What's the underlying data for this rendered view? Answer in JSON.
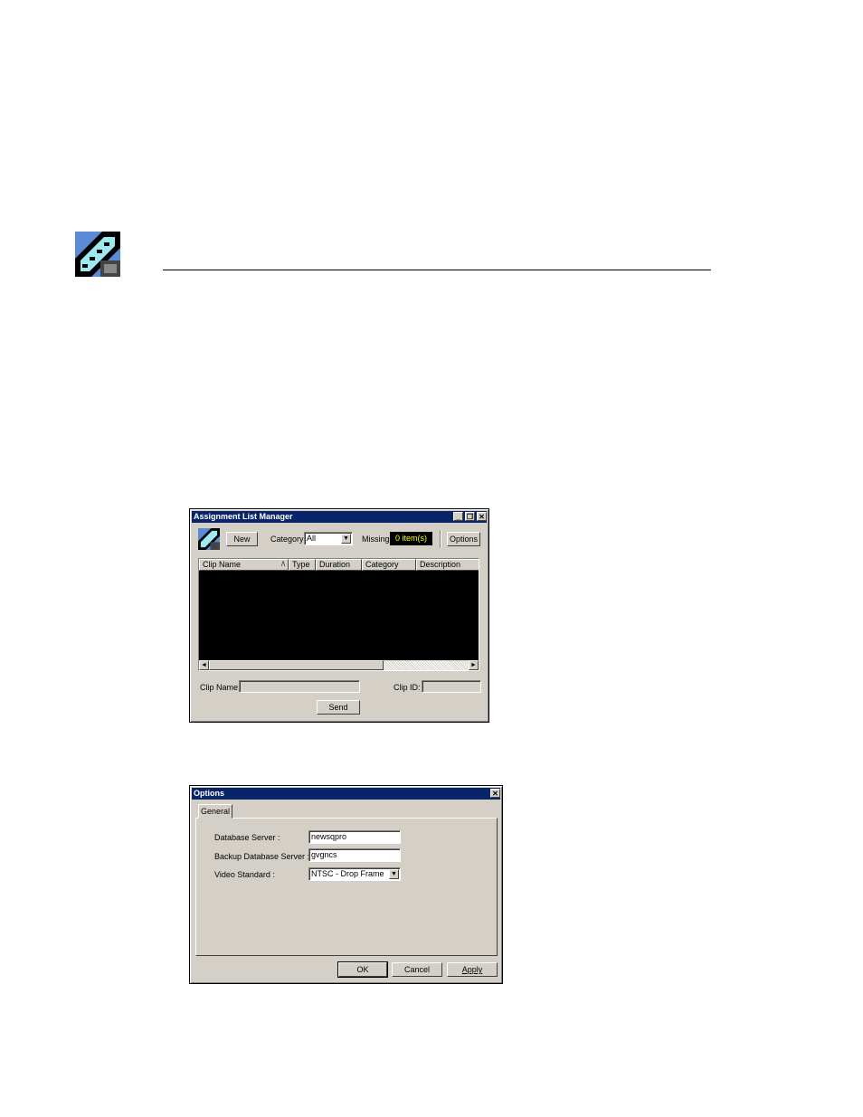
{
  "alm": {
    "title": "Assignment List Manager",
    "buttons": {
      "minimize": "_",
      "restore": "❐",
      "close": "✕"
    },
    "toolbar": {
      "new_label": "New",
      "category_label": "Category:",
      "category_value": "All",
      "missing_label": "Missing:",
      "missing_value": "0 item(s)",
      "options_label": "Options"
    },
    "columns": [
      "Clip Name",
      "Type",
      "Duration",
      "Category",
      "Description"
    ],
    "sort_indicator": "/\\",
    "clip_name_label": "Clip Name:",
    "clip_id_label": "Clip ID:",
    "send_label": "Send",
    "scroll_left": "◄",
    "scroll_right": "►"
  },
  "options": {
    "title": "Options",
    "close": "✕",
    "tab": "General",
    "database_server_label": "Database Server :",
    "database_server_value": "newsqpro",
    "backup_server_label": "Backup Database Server :",
    "backup_server_value": "gvgncs",
    "video_standard_label": "Video Standard :",
    "video_standard_value": "NTSC - Drop Frame",
    "ok_label": "OK",
    "cancel_label": "Cancel",
    "apply_label": "Apply"
  }
}
